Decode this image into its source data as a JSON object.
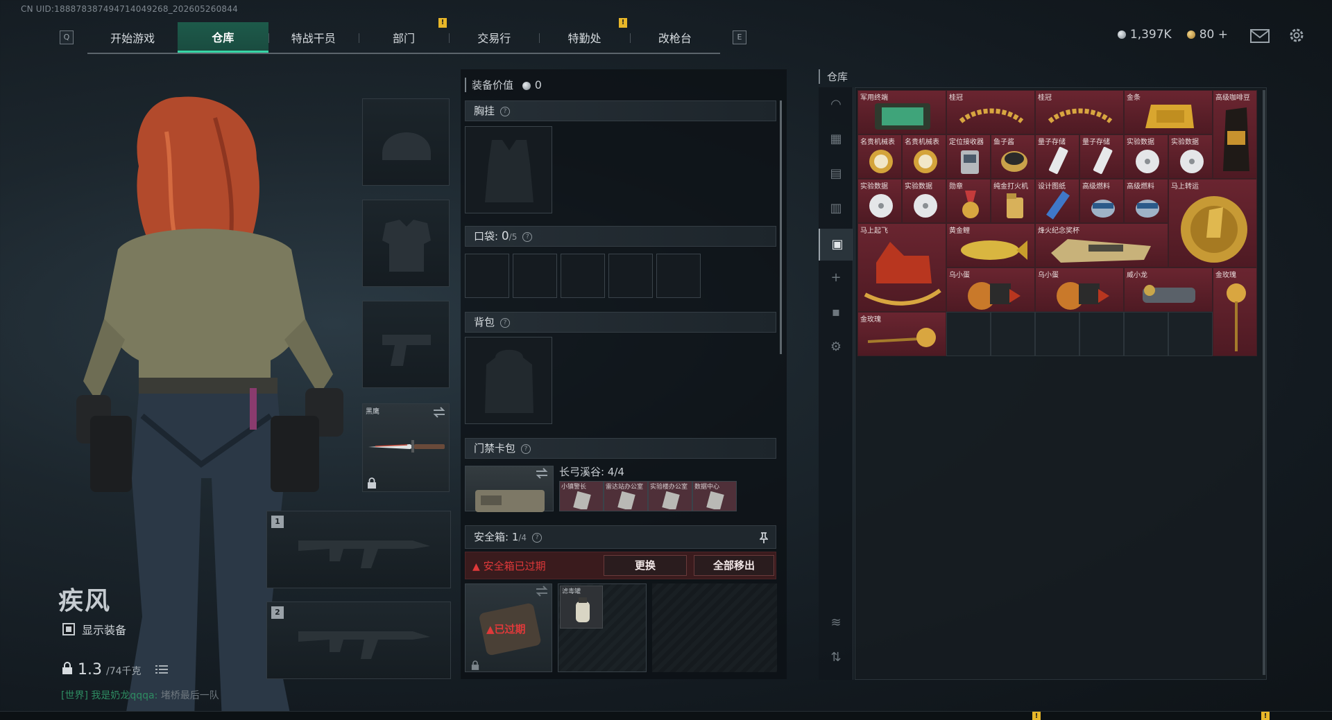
{
  "uid": "CN UID:188878387494714049268_202605260844",
  "nav": {
    "key_left": "Q",
    "key_right": "E",
    "tabs": [
      "开始游戏",
      "仓库",
      "特战干员",
      "部门",
      "交易行",
      "特勤处",
      "改枪台"
    ],
    "active_tab": "仓库",
    "warn_marker": "!"
  },
  "currency": {
    "silver": "1,397K",
    "gold": "80",
    "add": "+"
  },
  "character": {
    "name": "疾风",
    "show_equipment_label": "显示装备",
    "weight_current": "1.3",
    "weight_max": "/74千克",
    "chat_channel": "[世界]",
    "chat_name": "我是奶龙qqqa:",
    "chat_message": "堵桥最后一队"
  },
  "slots": {
    "melee_label": "黑鹰",
    "weapon1_num": "1",
    "weapon2_num": "2"
  },
  "mid": {
    "equip_value_label": "装备价值",
    "equip_value": "0",
    "chest_label": "胸挂",
    "pocket_label": "口袋:",
    "pocket_count": "0",
    "pocket_max": "/5",
    "backpack_label": "背包",
    "keycard_label": "门禁卡包",
    "keycard_map": "长弓溪谷: 4/4",
    "keycards": [
      "小镇警长",
      "雷达站办公室",
      "实验楼办公室",
      "数据中心"
    ],
    "safebox_label": "安全箱:",
    "safebox_count": "1",
    "safebox_max": "/4",
    "expired_notice": "安全箱已过期",
    "replace_button": "更换",
    "move_all_button": "全部移出",
    "expired_badge": "已过期",
    "safebox_item": "滤毒罐",
    "help": "?"
  },
  "warehouse": {
    "title": "仓库",
    "items": [
      {
        "label": "军用终端"
      },
      {
        "label": "桂冠"
      },
      {
        "label": "桂冠"
      },
      {
        "label": "金条"
      },
      {
        "label": "高级咖啡豆"
      },
      {
        "label": "名贵机械表"
      },
      {
        "label": "名贵机械表"
      },
      {
        "label": "定位接收器"
      },
      {
        "label": "鱼子酱"
      },
      {
        "label": "量子存储"
      },
      {
        "label": "量子存储"
      },
      {
        "label": "实验数据"
      },
      {
        "label": "实验数据"
      },
      {
        "label": "实验数据"
      },
      {
        "label": "实验数据"
      },
      {
        "label": "勋章"
      },
      {
        "label": "纯金打火机"
      },
      {
        "label": "设计图纸"
      },
      {
        "label": "高级燃料"
      },
      {
        "label": "高级燃料"
      },
      {
        "label": "马上转运"
      },
      {
        "label": "马上起飞"
      },
      {
        "label": "黄金鲤"
      },
      {
        "label": "烽火纪念奖杯"
      },
      {
        "label": "乌小蛋"
      },
      {
        "label": "乌小蛋"
      },
      {
        "label": "威小龙"
      },
      {
        "label": "金玫瑰"
      },
      {
        "label": "金玫瑰"
      }
    ]
  }
}
